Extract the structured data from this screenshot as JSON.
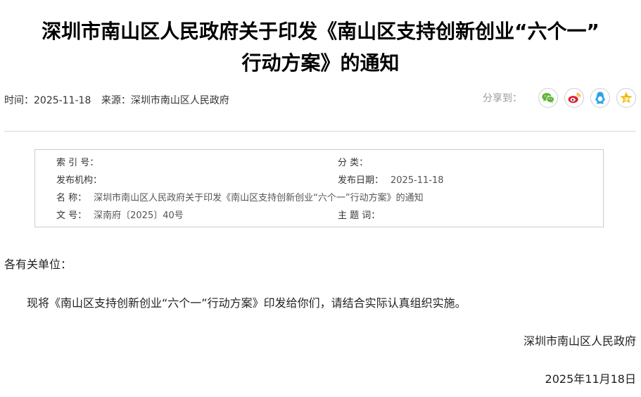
{
  "article": {
    "title_line1": "深圳市南山区人民政府关于印发《南山区支持创新创业“六个一”",
    "title_line2": "行动方案》的通知",
    "time_label": "时间：",
    "time_value": "2025-11-18",
    "source_label": "来源：",
    "source_value": "深圳市南山区人民政府"
  },
  "share": {
    "label": "分享到：",
    "targets": [
      {
        "icon": "wechat-icon",
        "color": "#5cb531"
      },
      {
        "icon": "weibo-icon",
        "color": "#e6162d"
      },
      {
        "icon": "qq-icon",
        "color": "#2aa3e6"
      },
      {
        "icon": "qzone-icon",
        "color": "#f5b800"
      }
    ]
  },
  "info": {
    "index_label": "索 引 号：",
    "index_value": "",
    "category_label": "分    类：",
    "category_value": "",
    "issuer_label": "发布机构：",
    "issuer_value": "",
    "date_label": "发布日期：",
    "date_value": "2025-11-18",
    "name_label": "名    称：",
    "name_value": "深圳市南山区人民政府关于印发《南山区支持创新创业“六个一”行动方案》的通知",
    "docno_label": "文    号：",
    "docno_value": "深南府〔2025〕40号",
    "keywords_label": "主 题 词：",
    "keywords_value": ""
  },
  "body": {
    "salutation": "各有关单位：",
    "paragraph": "现将《南山区支持创新创业“六个一”行动方案》印发给你们，请结合实际认真组织实施。",
    "signature": "深圳市南山区人民政府",
    "sign_date": "2025年11月18日"
  }
}
